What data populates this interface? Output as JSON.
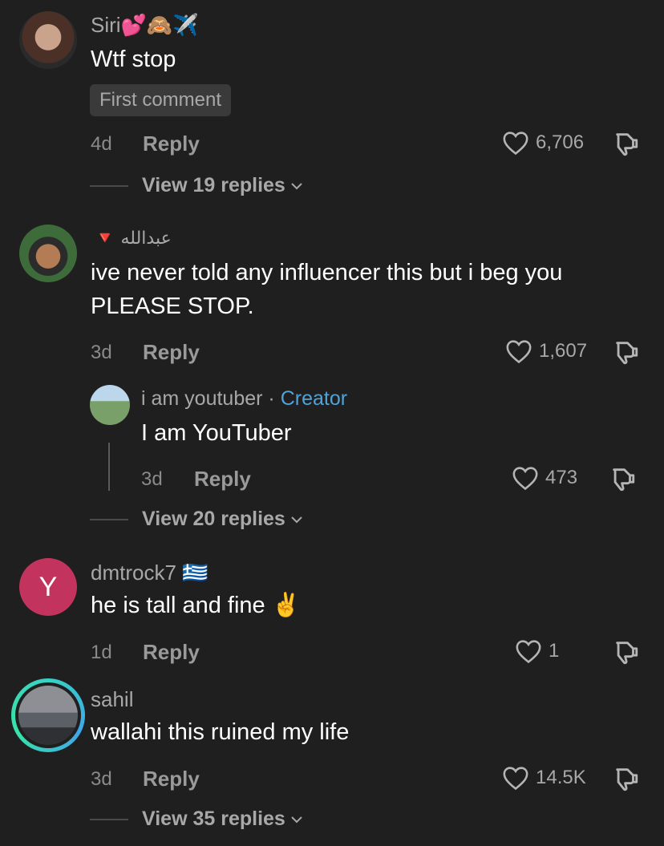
{
  "comments": [
    {
      "username": "Siri💕🙈✈️",
      "text": "Wtf stop",
      "badge": "First comment",
      "time": "4d",
      "reply_label": "Reply",
      "likes": "6,706",
      "view_replies": "View 19 replies"
    },
    {
      "username": "🔻 عبدالله",
      "text": "ive never told any influencer this but i beg you PLEASE STOP.",
      "time": "3d",
      "reply_label": "Reply",
      "likes": "1,607",
      "reply": {
        "username": "i am youtuber",
        "separator": "·",
        "creator_label": "Creator",
        "text": "I am YouTuber",
        "time": "3d",
        "reply_label": "Reply",
        "likes": "473"
      },
      "view_replies": "View 20 replies"
    },
    {
      "avatar_letter": "Y",
      "username": "dmtrock7 🇬🇷",
      "text": "he is tall and fine ✌️",
      "time": "1d",
      "reply_label": "Reply",
      "likes": "1"
    },
    {
      "username": "sahil",
      "text": "wallahi this ruined my life",
      "time": "3d",
      "reply_label": "Reply",
      "likes": "14.5K",
      "view_replies": "View 35 replies"
    }
  ],
  "colors": {
    "background": "#1f1f1f",
    "creator": "#4fa3d9",
    "avatar_y": "#c2345e"
  },
  "icons": [
    "heart-icon",
    "dislike-icon",
    "chevron-down-icon"
  ]
}
